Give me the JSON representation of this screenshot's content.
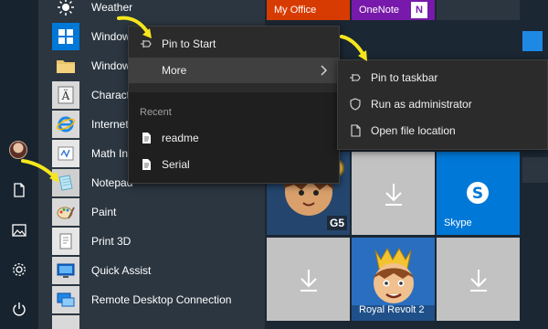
{
  "app_list": {
    "items": [
      {
        "label": "Weather",
        "icon": "weather-icon"
      },
      {
        "label": "Windows",
        "icon": "windows-logo-icon"
      },
      {
        "label": "Windows",
        "icon": "folder-icon"
      },
      {
        "label": "Characte",
        "icon": "character-map-icon"
      },
      {
        "label": "Internet",
        "icon": "internet-explorer-icon"
      },
      {
        "label": "Math Inp",
        "icon": "math-input-icon"
      },
      {
        "label": "Notepad",
        "icon": "notepad-icon"
      },
      {
        "label": "Paint",
        "icon": "paint-icon"
      },
      {
        "label": "Print 3D",
        "icon": "print-3d-icon"
      },
      {
        "label": "Quick Assist",
        "icon": "quick-assist-icon"
      },
      {
        "label": "Remote Desktop Connection",
        "icon": "remote-desktop-icon"
      }
    ]
  },
  "tiles": {
    "my_office": "My Office",
    "onenote": "OneNote",
    "skype": "Skype",
    "royal_revolt": "Royal Revolt 2",
    "gameloft_badge": "G5"
  },
  "context_menu": {
    "pin_to_start": "Pin to Start",
    "more": "More",
    "recent_title": "Recent",
    "recent_items": [
      "readme",
      "Serial"
    ]
  },
  "more_submenu": {
    "pin_to_taskbar": "Pin to taskbar",
    "run_as_admin": "Run as administrator",
    "open_file_location": "Open file location"
  },
  "colors": {
    "accent_blue": "#0078d7",
    "office_red": "#d83b01",
    "onenote_purple": "#7719aa",
    "placeholder_tile": "#c2c2c2",
    "annotation_yellow": "#f5e61d"
  }
}
